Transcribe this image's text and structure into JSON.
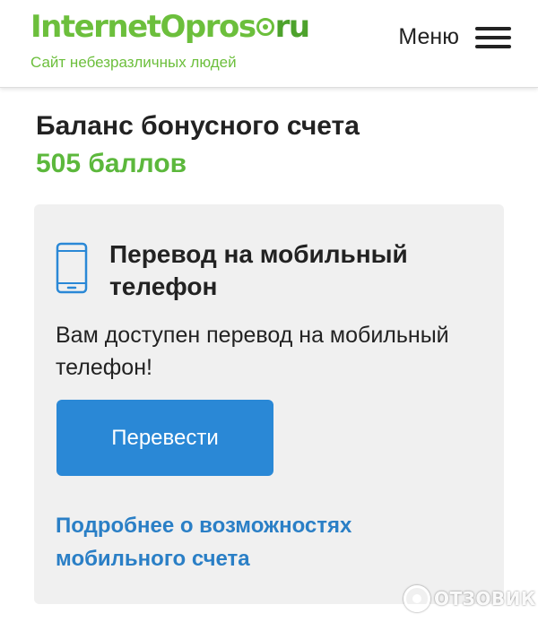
{
  "header": {
    "logo": {
      "part1": "InternetOpros",
      "part2": "ru",
      "icon": "circle-dot-icon"
    },
    "tagline": "Сайт небезразличных людей",
    "menu_label": "Меню",
    "menu_icon": "hamburger-icon"
  },
  "balance": {
    "title": "Баланс бонусного счета",
    "value": "505 баллов"
  },
  "card": {
    "icon": "mobile-phone-icon",
    "title": "Перевод на мобильный телефон",
    "description": "Вам доступен перевод на мобильный телефон!",
    "button_label": "Перевести",
    "link_text": "Подробнее о возможностях мобильного счета"
  },
  "watermark": {
    "text": "ОТЗОВИК",
    "icon": "otzovik-logo-icon"
  },
  "colors": {
    "brand_green": "#6cbf3c",
    "balance_green": "#5cb83c",
    "button_blue": "#2a88d6",
    "link_blue": "#2a7fc6",
    "card_background": "#f0f0f0"
  }
}
